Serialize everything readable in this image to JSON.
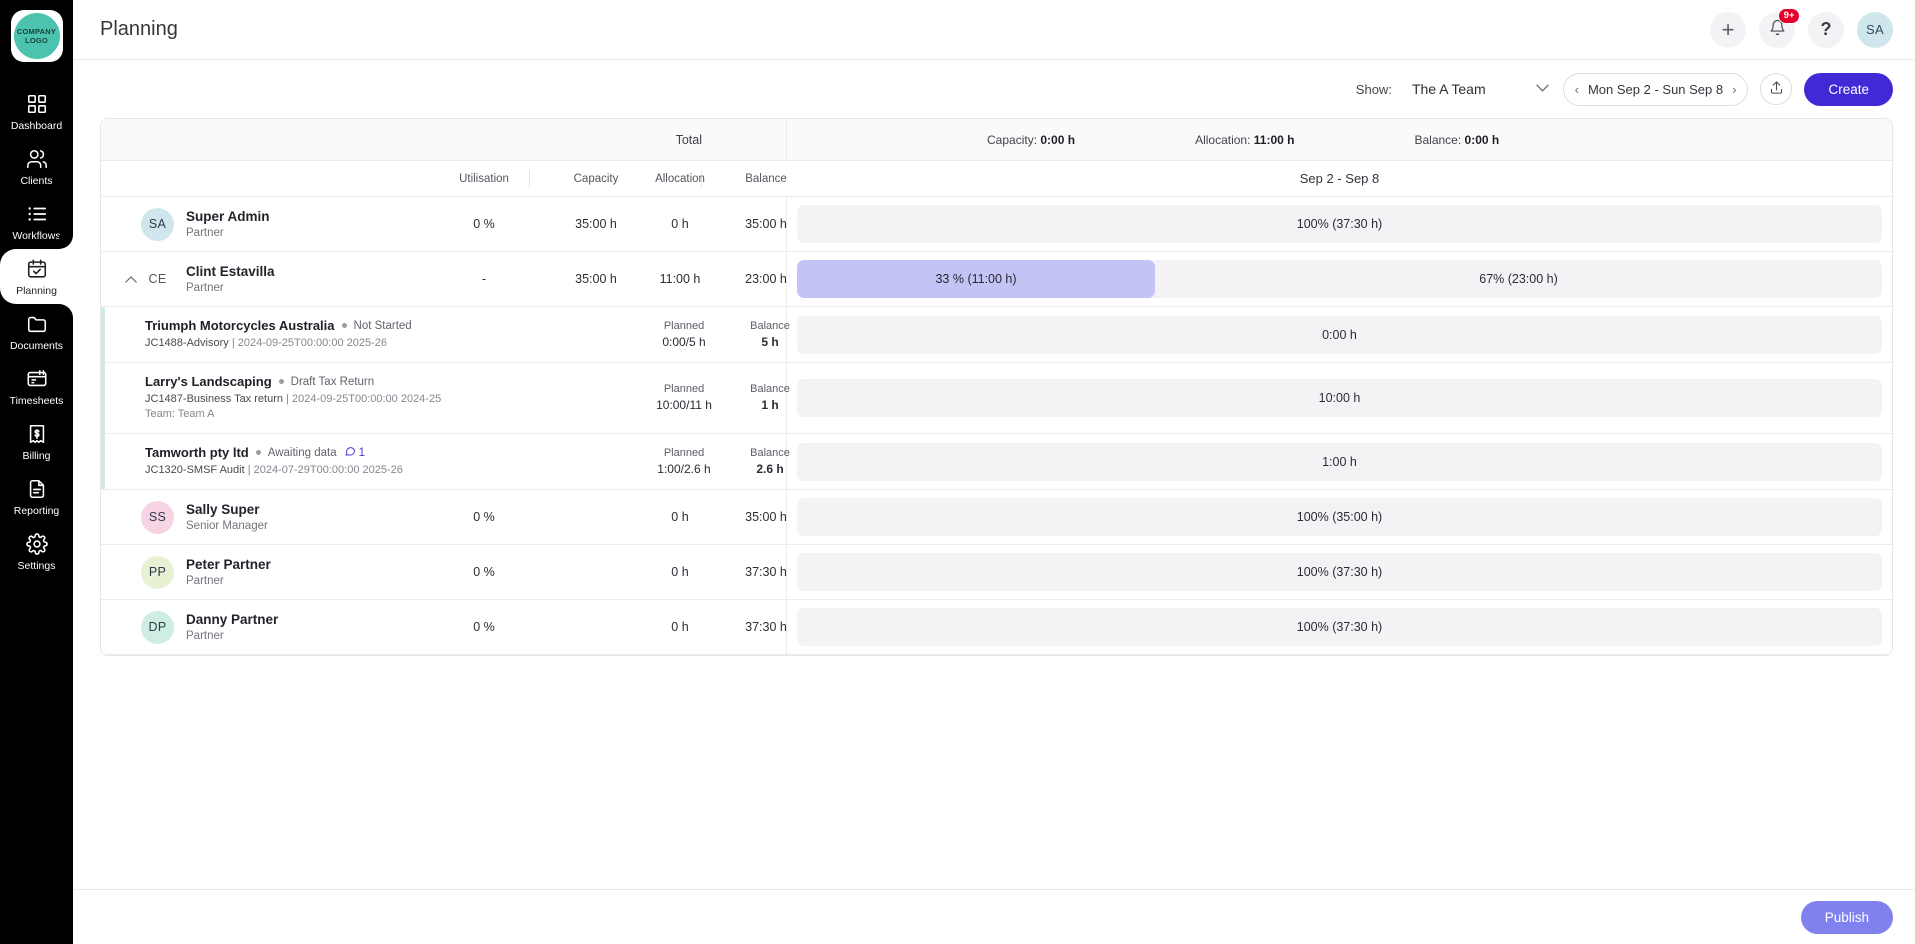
{
  "sidebar": {
    "logo": {
      "line1": "COMPANY",
      "line2": "LOGO"
    },
    "items": [
      {
        "label": "Dashboard",
        "icon": "dashboard-icon",
        "active": false
      },
      {
        "label": "Clients",
        "icon": "clients-icon",
        "active": false
      },
      {
        "label": "Workflows",
        "icon": "workflows-icon",
        "active": false
      },
      {
        "label": "Planning",
        "icon": "planning-icon",
        "active": true
      },
      {
        "label": "Documents",
        "icon": "documents-icon",
        "active": false
      },
      {
        "label": "Timesheets",
        "icon": "timesheets-icon",
        "active": false
      },
      {
        "label": "Billing",
        "icon": "billing-icon",
        "active": false
      },
      {
        "label": "Reporting",
        "icon": "reporting-icon",
        "active": false
      },
      {
        "label": "Settings",
        "icon": "settings-icon",
        "active": false
      }
    ]
  },
  "header": {
    "title": "Planning",
    "add_label": "+",
    "notification_badge": "9+",
    "help_label": "?",
    "avatar_initials": "SA"
  },
  "toolbar": {
    "show_label": "Show:",
    "team_value": "The A Team",
    "date_range": "Mon Sep 2 - Sun Sep 8",
    "prev_label": "‹",
    "next_label": "›",
    "create_label": "Create"
  },
  "summary": {
    "total_label": "Total",
    "capacity_label": "Capacity:",
    "capacity_value": "0:00 h",
    "allocation_label": "Allocation:",
    "allocation_value": "11:00 h",
    "balance_label": "Balance:",
    "balance_value": "0:00 h"
  },
  "columns": {
    "utilisation": "Utilisation",
    "capacity": "Capacity",
    "allocation": "Allocation",
    "balance": "Balance",
    "period": "Sep 2 - Sep 8"
  },
  "rows": [
    {
      "type": "person",
      "initials": "SA",
      "avatar_color": "#cfe6ec",
      "name": "Super Admin",
      "role": "Partner",
      "utilisation": "0 %",
      "capacity": "35:00 h",
      "allocation": "0 h",
      "balance": "35:00 h",
      "bar": {
        "fill_pct": 0,
        "fill_label": "",
        "rest_label": "100% (37:30 h)"
      },
      "expanded": false
    },
    {
      "type": "person",
      "initials": "CE",
      "avatar_color": "transparent",
      "name": "Clint Estavilla",
      "role": "Partner",
      "utilisation": "-",
      "capacity": "35:00 h",
      "allocation": "11:00 h",
      "balance": "23:00 h",
      "bar": {
        "fill_pct": 33,
        "fill_label": "33 % (11:00 h)",
        "rest_label": "67% (23:00 h)"
      },
      "expanded": true
    },
    {
      "type": "job",
      "name": "Triumph Motorcycles Australia",
      "status": "Not Started",
      "job_id": "JC1488-Advisory",
      "meta": "2024-09-25T00:00:00 2025-26",
      "team": "",
      "comments": "",
      "planned_label": "Planned",
      "planned_value": "0:00/5 h",
      "balance_label": "Balance",
      "balance_value": "5 h",
      "bar_label": "0:00 h"
    },
    {
      "type": "job",
      "name": "Larry's Landscaping",
      "status": "Draft Tax Return",
      "job_id": "JC1487-Business Tax return",
      "meta": "2024-09-25T00:00:00 2024-25",
      "team": "Team: Team A",
      "comments": "",
      "planned_label": "Planned",
      "planned_value": "10:00/11 h",
      "balance_label": "Balance",
      "balance_value": "1 h",
      "bar_label": "10:00 h"
    },
    {
      "type": "job",
      "name": "Tamworth pty ltd",
      "status": "Awaiting data",
      "job_id": "JC1320-SMSF Audit",
      "meta": "2024-07-29T00:00:00 2025-26",
      "team": "",
      "comments": "1",
      "planned_label": "Planned",
      "planned_value": "1:00/2.6 h",
      "balance_label": "Balance",
      "balance_value": "2.6 h",
      "bar_label": "1:00 h"
    },
    {
      "type": "person",
      "initials": "SS",
      "avatar_color": "#f6d4e4",
      "name": "Sally Super",
      "role": "Senior Manager",
      "utilisation": "0 %",
      "capacity": "",
      "allocation": "0 h",
      "balance": "35:00 h",
      "bar": {
        "fill_pct": 0,
        "fill_label": "",
        "rest_label": "100% (35:00 h)"
      },
      "expanded": false
    },
    {
      "type": "person",
      "initials": "PP",
      "avatar_color": "#e7f1d3",
      "name": "Peter Partner",
      "role": "Partner",
      "utilisation": "0 %",
      "capacity": "",
      "allocation": "0 h",
      "balance": "37:30 h",
      "bar": {
        "fill_pct": 0,
        "fill_label": "",
        "rest_label": "100% (37:30 h)"
      },
      "expanded": false
    },
    {
      "type": "person",
      "initials": "DP",
      "avatar_color": "#cfeee3",
      "name": "Danny Partner",
      "role": "Partner",
      "utilisation": "0 %",
      "capacity": "",
      "allocation": "0 h",
      "balance": "37:30 h",
      "bar": {
        "fill_pct": 0,
        "fill_label": "",
        "rest_label": "100% (37:30 h)"
      },
      "expanded": false
    }
  ],
  "footer": {
    "publish_label": "Publish"
  },
  "colors": {
    "accent": "#3f2ad6",
    "bar_fill": "#c3c4f5",
    "badge": "#e4002b",
    "logo": "#4cc3ae",
    "job_stripe": "#cfeae4"
  }
}
